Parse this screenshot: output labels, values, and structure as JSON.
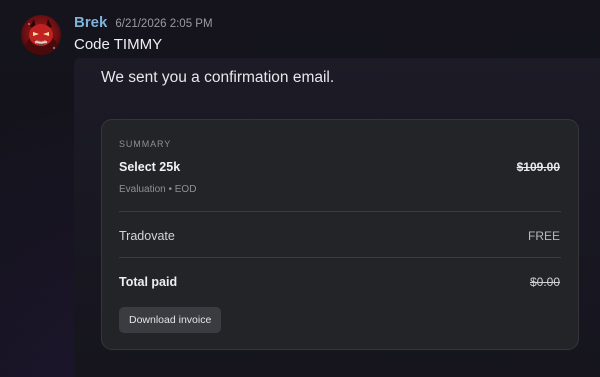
{
  "message": {
    "author": "Brek",
    "timestamp": "6/21/2026 2:05 PM",
    "text": "Code TIMMY",
    "avatar_icon": "red-demon-avatar",
    "author_color": "#7fb3d9"
  },
  "attachment": {
    "confirmation_text": "We sent you a confirmation email.",
    "summary": {
      "section_label": "SUMMARY",
      "plan_name": "Select 25k",
      "plan_price": "$109.00",
      "plan_detail": "Evaluation • EOD",
      "platform_label": "Tradovate",
      "platform_value": "FREE",
      "total_label": "Total paid",
      "total_value": "$0.00",
      "download_button": "Download invoice"
    }
  }
}
